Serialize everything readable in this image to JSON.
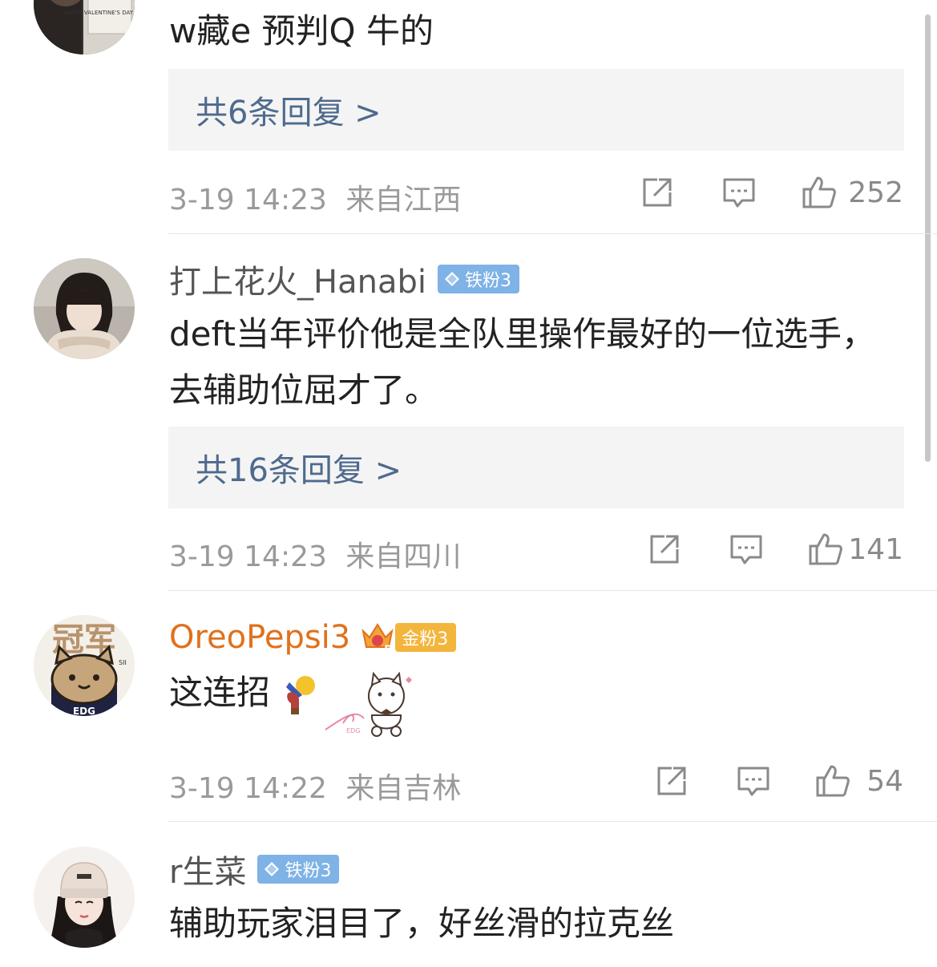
{
  "comments": [
    {
      "username": "",
      "body": "w藏e   预判Q  牛的",
      "replies": "共6条回复 >",
      "time": "3-19 14:23",
      "location": "来自江西",
      "likes": "252"
    },
    {
      "username": "打上花火_Hanabi",
      "badge": "铁粉3",
      "body": "deft当年评价他是全队里操作最好的一位选手，去辅助位屈才了。",
      "replies": "共16条回复 >",
      "time": "3-19 14:23",
      "location": "来自四川",
      "likes": "141"
    },
    {
      "username": "OreoPepsi3",
      "badge": "金粉3",
      "crown_level": "5",
      "body": "这连招",
      "time": "3-19 14:22",
      "location": "来自吉林",
      "likes": "54"
    },
    {
      "username": "r生菜",
      "badge": "铁粉3",
      "body": "辅助玩家泪目了，好丝滑的拉克丝"
    }
  ],
  "avatar_texts": {
    "first_sign": "HAPPY VALENTINE'S DAY, HEGEL",
    "third_top": "冠军",
    "third_tag": "EDG",
    "third_sii": "SII"
  },
  "sticker_text": "EDG",
  "colors": {
    "reply_link": "#4e6a8e",
    "iron_badge": "#7fb2e6",
    "gold_badge": "#f3b53c",
    "gold_name": "#e0711c",
    "meta_gray": "#9a9a9a"
  },
  "icons": [
    "share-icon",
    "comment-icon",
    "like-icon"
  ]
}
